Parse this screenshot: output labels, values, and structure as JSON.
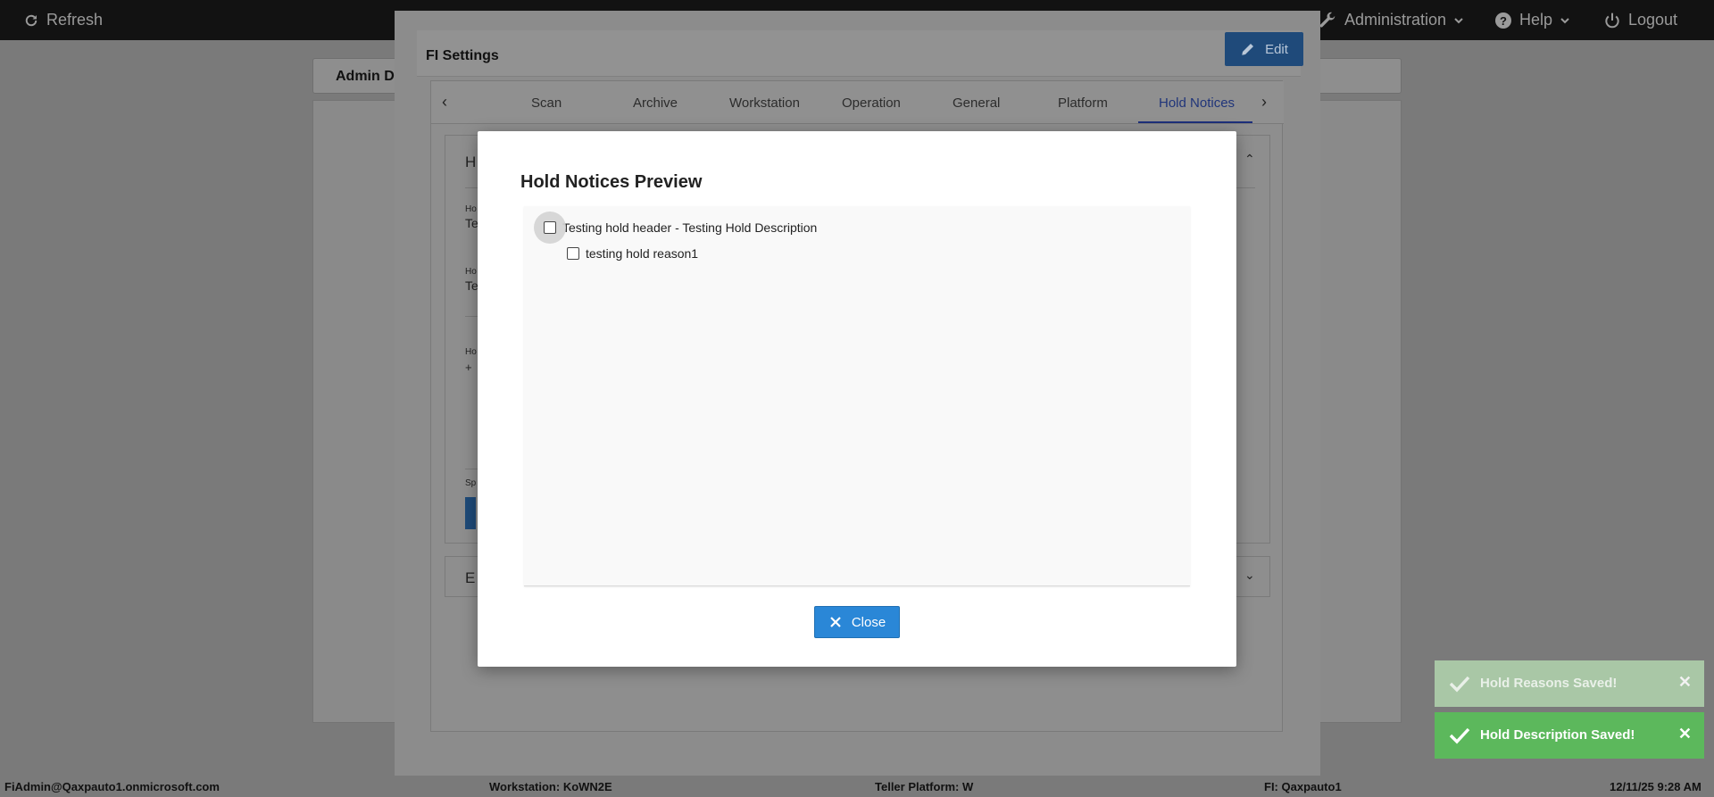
{
  "topbar": {
    "refresh_label": "Refresh",
    "administration_label": "Administration",
    "help_label": "Help",
    "logout_label": "Logout"
  },
  "page": {
    "breadcrumb": "Admin D"
  },
  "fi_settings": {
    "title": "FI Settings",
    "edit_label": "Edit",
    "tabs": [
      {
        "label": "Scan",
        "active": false
      },
      {
        "label": "Archive",
        "active": false
      },
      {
        "label": "Workstation",
        "active": false
      },
      {
        "label": "Operation",
        "active": false
      },
      {
        "label": "General",
        "active": false
      },
      {
        "label": "Platform",
        "active": false
      },
      {
        "label": "Hold Notices",
        "active": true
      }
    ],
    "card1_fragments": {
      "heading": "H",
      "label1": "Ho",
      "value1": "Te",
      "label2": "Ho",
      "value2": "Te",
      "label3": "Ho",
      "add": "+",
      "label4": "Sp"
    },
    "card2_fragment": "E"
  },
  "preview": {
    "title": "Hold Notices Preview",
    "items": [
      {
        "label": "Testing hold header - Testing Hold Description",
        "checked": false,
        "children": [
          {
            "label": "testing hold reason1",
            "checked": false
          }
        ]
      }
    ],
    "close_label": "Close"
  },
  "toasts": [
    {
      "text": "Hold Reasons Saved!",
      "state": "fading"
    },
    {
      "text": "Hold Description Saved!",
      "state": "visible"
    }
  ],
  "footer": {
    "user": "FiAdmin@Qaxpauto1.onmicrosoft.com",
    "workstation": "Workstation: KoWN2E",
    "teller_platform": "Teller Platform: W",
    "fi": "FI: Qaxpauto1",
    "datetime": "12/11/25 9:28 AM"
  },
  "colors": {
    "accent_blue": "#2a87d7",
    "toast_success": "#5cb85c",
    "active_tab": "#20357a"
  }
}
